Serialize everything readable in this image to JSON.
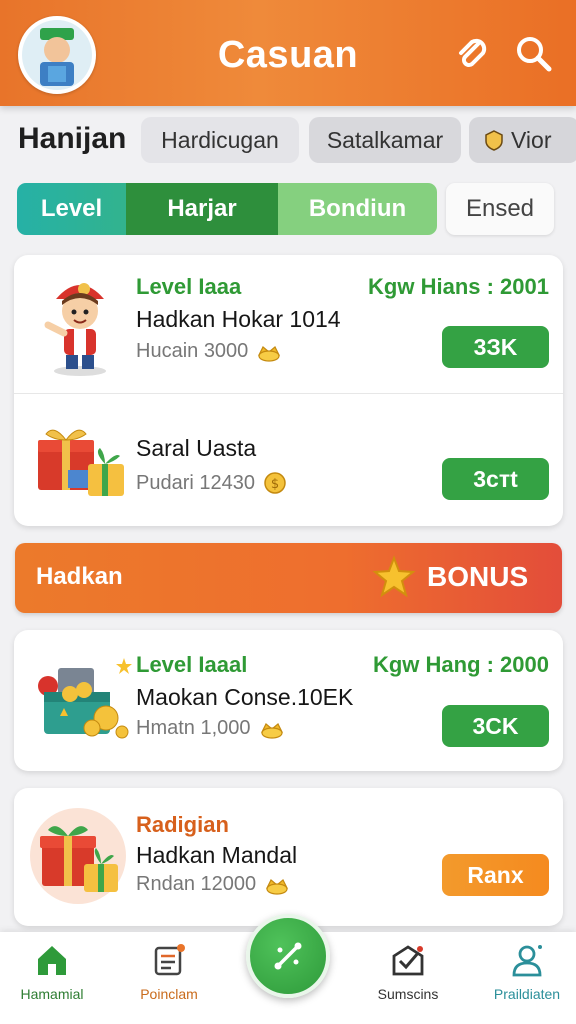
{
  "header": {
    "title": "Casuan",
    "icons": [
      "avatar",
      "paperclip-icon",
      "search-icon"
    ]
  },
  "categories": {
    "title": "Hanijan",
    "chips": [
      "Hardicugan",
      "Satalkamar",
      "Vior"
    ]
  },
  "tabs": [
    "Level",
    "Harjar",
    "Bondiun",
    "Ensed"
  ],
  "card1": {
    "row1": {
      "level": "Level Iaaa",
      "rank": "Kgw Hians : 2001",
      "name": "Hadkan Hokar 1014",
      "sub": "Hucain 3000",
      "button": "3ЗK"
    },
    "row2": {
      "name": "Saral Uasta",
      "sub": "Pudarі 12430",
      "button": "3cтt"
    }
  },
  "banner": {
    "title": "Hadkan",
    "bonus": "BONUS"
  },
  "card2": {
    "level": "Level Iaaal",
    "rank": "Kgw Hang : 2000",
    "name": "Maokan Conse.10EK",
    "sub": "Hmatn 1,000",
    "button": "3CK"
  },
  "card3": {
    "level": "Radigian",
    "name": "Hadkan Mandal",
    "sub": "Rndan 12000",
    "button": "Ranx"
  },
  "bottom_nav": [
    "Hamamial",
    "Poinclam",
    "Sumscins",
    "Praildiaten"
  ],
  "colors": {
    "header": "#e8742a",
    "green": "#2f9a35",
    "button_green": "#34a244",
    "button_orange": "#f5921f",
    "banner": "#ec7a2b",
    "teal": "#26b1a6"
  }
}
